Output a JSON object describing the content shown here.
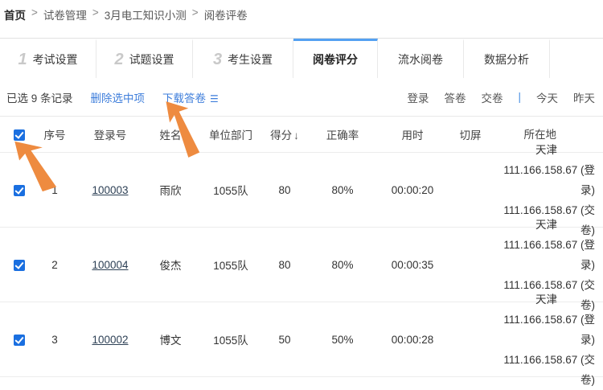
{
  "breadcrumb": {
    "separator": ">",
    "items": [
      "首页",
      "试卷管理",
      "3月电工知识小测",
      "阅卷评卷"
    ]
  },
  "tabs": [
    {
      "num": "1",
      "label": "考试设置"
    },
    {
      "num": "2",
      "label": "试题设置"
    },
    {
      "num": "3",
      "label": "考生设置"
    },
    {
      "num": "",
      "label": "阅卷评分"
    },
    {
      "num": "",
      "label": "流水阅卷"
    },
    {
      "num": "",
      "label": "数据分析"
    }
  ],
  "toolbar": {
    "selected_info": "已选 9 条记录",
    "delete_label": "删除选中项",
    "download_label": "下载答卷",
    "download_icon": "☰",
    "filters": [
      "登录",
      "答卷",
      "交卷"
    ],
    "filter_separator": "|",
    "date_filters": [
      "今天",
      "昨天"
    ]
  },
  "table": {
    "columns": [
      "序号",
      "登录号",
      "姓名",
      "单位部门",
      "得分",
      "正确率",
      "用时",
      "切屏",
      "所在地"
    ],
    "sort_column": "得分",
    "sort_icon": "↓",
    "rows": [
      {
        "index": "1",
        "login": "100003",
        "name": "雨欣",
        "dept": "1055队",
        "score": "80",
        "accuracy": "80%",
        "duration": "00:00:20",
        "switches": "",
        "location_city": "天津",
        "location_login": "111.166.158.67 (登录)",
        "location_submit": "111.166.158.67 (交卷)"
      },
      {
        "index": "2",
        "login": "100004",
        "name": "俊杰",
        "dept": "1055队",
        "score": "80",
        "accuracy": "80%",
        "duration": "00:00:35",
        "switches": "",
        "location_city": "天津",
        "location_login": "111.166.158.67 (登录)",
        "location_submit": "111.166.158.67 (交卷)"
      },
      {
        "index": "3",
        "login": "100002",
        "name": "博文",
        "dept": "1055队",
        "score": "50",
        "accuracy": "50%",
        "duration": "00:00:28",
        "switches": "",
        "location_city": "天津",
        "location_login": "111.166.158.67 (登录)",
        "location_submit": "111.166.158.67 (交卷)"
      }
    ]
  },
  "colors": {
    "accent_blue": "#3e7edb",
    "checkbox_blue": "#1a6fe0",
    "active_tab_blue": "#54a1f2",
    "annotation_orange": "#ee8b40"
  }
}
